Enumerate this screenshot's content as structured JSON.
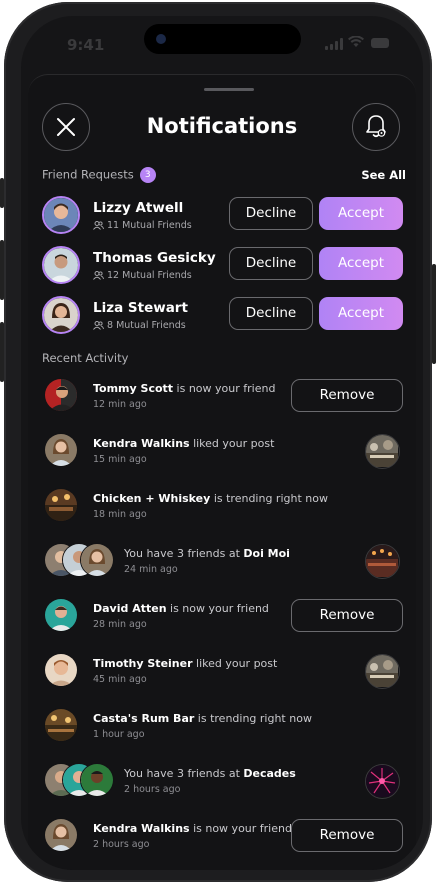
{
  "status_bar": {
    "time": "9:41"
  },
  "header": {
    "title": "Notifications",
    "close_icon": "close-icon",
    "bell_icon": "bell-settings-icon"
  },
  "friend_requests": {
    "label": "Friend Requests",
    "count": "3",
    "see_all": "See All",
    "decline_label": "Decline",
    "accept_label": "Accept",
    "items": [
      {
        "name": "Lizzy Atwell",
        "mutual": "11 Mutual Friends"
      },
      {
        "name": "Thomas Gesicky",
        "mutual": "12 Mutual Friends"
      },
      {
        "name": "Liza Stewart",
        "mutual": "8 Mutual Friends"
      }
    ]
  },
  "recent_activity": {
    "label": "Recent Activity",
    "remove_label": "Remove",
    "items": [
      {
        "subject": "Tommy Scott",
        "pre": "",
        "text": " is now your friend",
        "time": "12 min ago"
      },
      {
        "subject": "Kendra Walkins",
        "pre": "",
        "text": " liked your post",
        "time": "15 min ago"
      },
      {
        "subject": "Chicken + Whiskey",
        "pre": "",
        "text": " is trending right now",
        "time": "18 min ago"
      },
      {
        "subject": "Doi Moi",
        "pre": "You have 3 friends at ",
        "text": "",
        "time": "24 min ago"
      },
      {
        "subject": "David Atten",
        "pre": "",
        "text": " is now your friend",
        "time": "28 min ago"
      },
      {
        "subject": "Timothy Steiner",
        "pre": "",
        "text": " liked your post",
        "time": "45 min ago"
      },
      {
        "subject": "Casta's Rum Bar",
        "pre": "",
        "text": " is trending right now",
        "time": "1 hour ago"
      },
      {
        "subject": "Decades",
        "pre": "You have 3 friends at ",
        "text": "",
        "time": "2 hours ago"
      },
      {
        "subject": "Kendra Walkins",
        "pre": "",
        "text": " is now your friend",
        "time": "2 hours ago"
      }
    ]
  },
  "colors": {
    "accent": "#b784f5",
    "background": "#131315"
  }
}
